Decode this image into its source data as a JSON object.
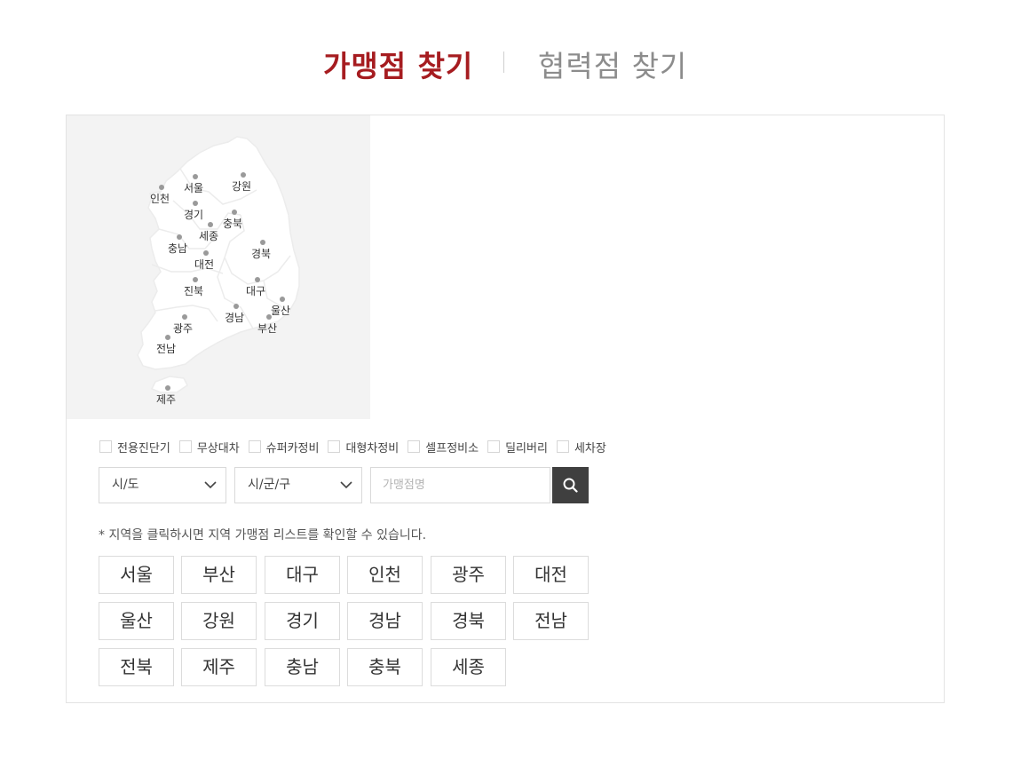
{
  "tabs": {
    "franchise": "가맹점 찾기",
    "partner": "협력점 찾기"
  },
  "map": {
    "regions": [
      {
        "name": "seoul",
        "label": "서울"
      },
      {
        "name": "gangwon",
        "label": "강원"
      },
      {
        "name": "incheon",
        "label": "인천"
      },
      {
        "name": "gyeonggi",
        "label": "경기"
      },
      {
        "name": "chungbuk",
        "label": "충북"
      },
      {
        "name": "sejong",
        "label": "세종"
      },
      {
        "name": "chungnam",
        "label": "충남"
      },
      {
        "name": "gyeongbuk",
        "label": "경북"
      },
      {
        "name": "daejeon",
        "label": "대전"
      },
      {
        "name": "jeonbuk",
        "label": "진북"
      },
      {
        "name": "daegu",
        "label": "대구"
      },
      {
        "name": "ulsan",
        "label": "울산"
      },
      {
        "name": "gyeongnam",
        "label": "경남"
      },
      {
        "name": "gwangju",
        "label": "광주"
      },
      {
        "name": "busan",
        "label": "부산"
      },
      {
        "name": "jeonnam",
        "label": "전남"
      },
      {
        "name": "jeju",
        "label": "제주"
      }
    ]
  },
  "filters": [
    "전용진단기",
    "무상대차",
    "슈퍼카정비",
    "대형차정비",
    "셀프정비소",
    "딜리버리",
    "세차장"
  ],
  "search": {
    "sido_value": "시/도",
    "gugun_value": "시/군/구",
    "name_placeholder": "가맹점명"
  },
  "note": "* 지역을 클릭하시면 지역 가맹점 리스트를 확인할 수 있습니다.",
  "region_buttons": [
    "서울",
    "부산",
    "대구",
    "인천",
    "광주",
    "대전",
    "울산",
    "강원",
    "경기",
    "경남",
    "경북",
    "전남",
    "전북",
    "제주",
    "충남",
    "충북",
    "세종"
  ],
  "colors": {
    "accent": "#a61c20",
    "inactive_tab": "#8c8c8c",
    "search_button": "#3f3f3f",
    "map_bg": "#f3f3f3"
  }
}
